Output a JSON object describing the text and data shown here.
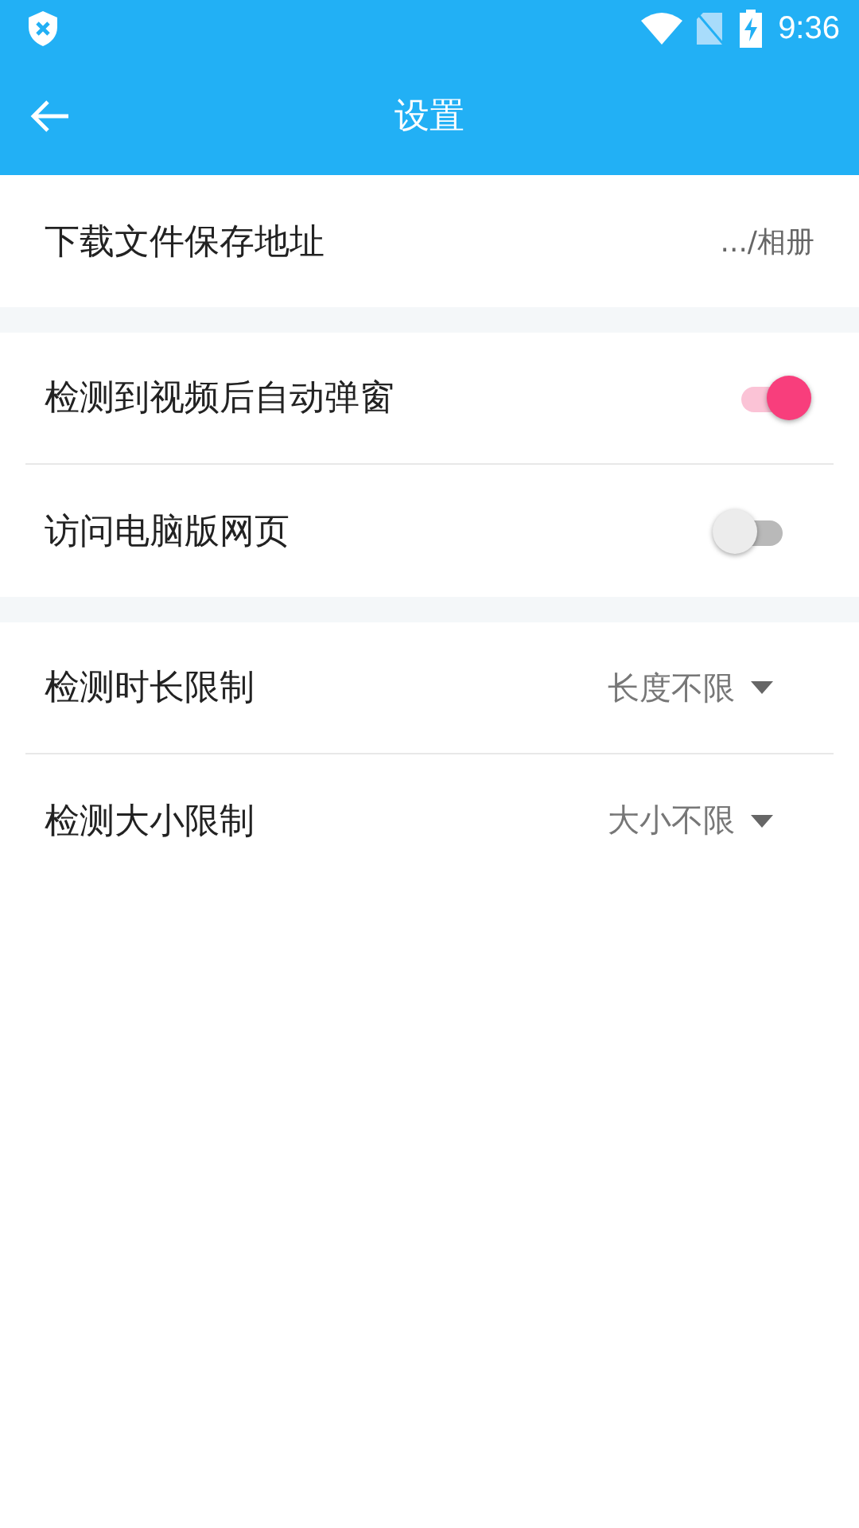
{
  "status_bar": {
    "time": "9:36"
  },
  "app_bar": {
    "title": "设置"
  },
  "sections": [
    {
      "rows": [
        {
          "kind": "value",
          "label": "下载文件保存地址",
          "value": ".../相册"
        }
      ]
    },
    {
      "rows": [
        {
          "kind": "switch",
          "label": "检测到视频后自动弹窗",
          "on": true
        },
        {
          "kind": "switch",
          "label": "访问电脑版网页",
          "on": false
        }
      ]
    },
    {
      "rows": [
        {
          "kind": "dropdown",
          "label": "检测时长限制",
          "value": "长度不限"
        },
        {
          "kind": "dropdown",
          "label": "检测大小限制",
          "value": "大小不限"
        }
      ]
    }
  ]
}
